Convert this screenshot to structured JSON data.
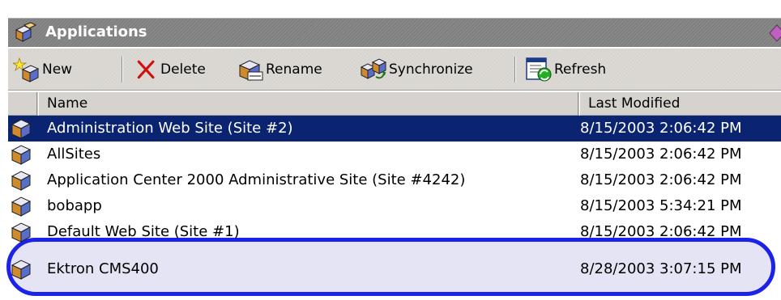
{
  "window": {
    "title": "Applications"
  },
  "toolbar": {
    "new_label": "New",
    "delete_label": "Delete",
    "rename_label": "Rename",
    "synchronize_label": "Synchronize",
    "refresh_label": "Refresh"
  },
  "list": {
    "columns": {
      "name": "Name",
      "last_modified": "Last Modified"
    },
    "rows": [
      {
        "name": "Administration Web Site (Site #2)",
        "last_modified": "8/15/2003 2:06:42 PM",
        "selected": true
      },
      {
        "name": "AllSites",
        "last_modified": "8/15/2003 2:06:42 PM"
      },
      {
        "name": "Application Center 2000 Administrative Site (Site #4242)",
        "last_modified": "8/15/2003 2:06:42 PM"
      },
      {
        "name": "bobapp",
        "last_modified": "8/15/2003 5:34:21 PM"
      },
      {
        "name": "Default Web Site (Site #1)",
        "last_modified": "8/15/2003 2:06:42 PM"
      },
      {
        "name": "Ektron CMS400",
        "last_modified": "8/28/2003 3:07:15 PM"
      }
    ]
  },
  "colors": {
    "selection": "#0a2472",
    "highlight_outline": "#1c22e8",
    "title_bar": "#808080"
  },
  "icons": {
    "title": "applications-icon",
    "new": "new-sparkle-icon",
    "delete": "red-x-delete-icon",
    "rename": "rename-icon",
    "synchronize": "synchronize-icon",
    "refresh": "refresh-icon",
    "row": "application-package-icon"
  }
}
